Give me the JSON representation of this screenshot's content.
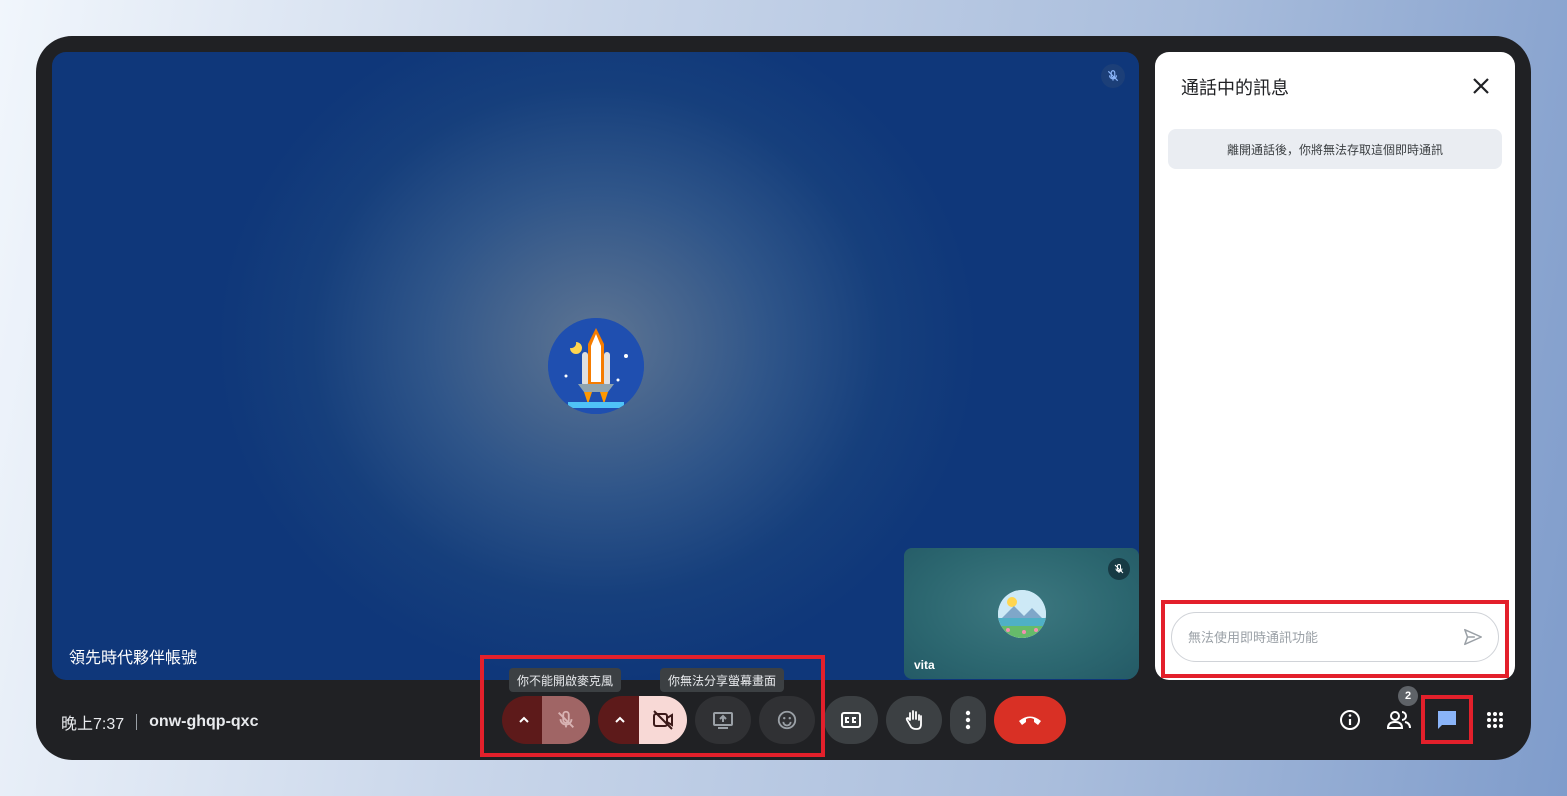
{
  "meeting": {
    "time": "晚上7:37",
    "code": "onw-ghqp-qxc"
  },
  "main_participant": {
    "name": "領先時代夥伴帳號",
    "avatar_icon": "space-shuttle-icon",
    "muted": true
  },
  "self_participant": {
    "name": "vita",
    "avatar_icon": "landscape-icon",
    "muted": true
  },
  "chat_panel": {
    "title": "通話中的訊息",
    "notice": "離開通話後，你將無法存取這個即時通訊",
    "input_placeholder": "無法使用即時通訊功能"
  },
  "tooltips": {
    "mic": "你不能開啟麥克風",
    "screen_share": "你無法分享螢幕畫面"
  },
  "toolbar": {
    "buttons": [
      "mic-options",
      "microphone",
      "camera-options",
      "camera",
      "present",
      "reactions",
      "captions",
      "raise-hand",
      "more-options",
      "leave-call"
    ]
  },
  "right_tools": {
    "people_count": "2",
    "buttons": [
      "info",
      "people",
      "chat",
      "activities"
    ]
  },
  "colors": {
    "end_call": "#d93025",
    "highlight": "#e3202b",
    "chat_active": "#8ab4f8"
  }
}
